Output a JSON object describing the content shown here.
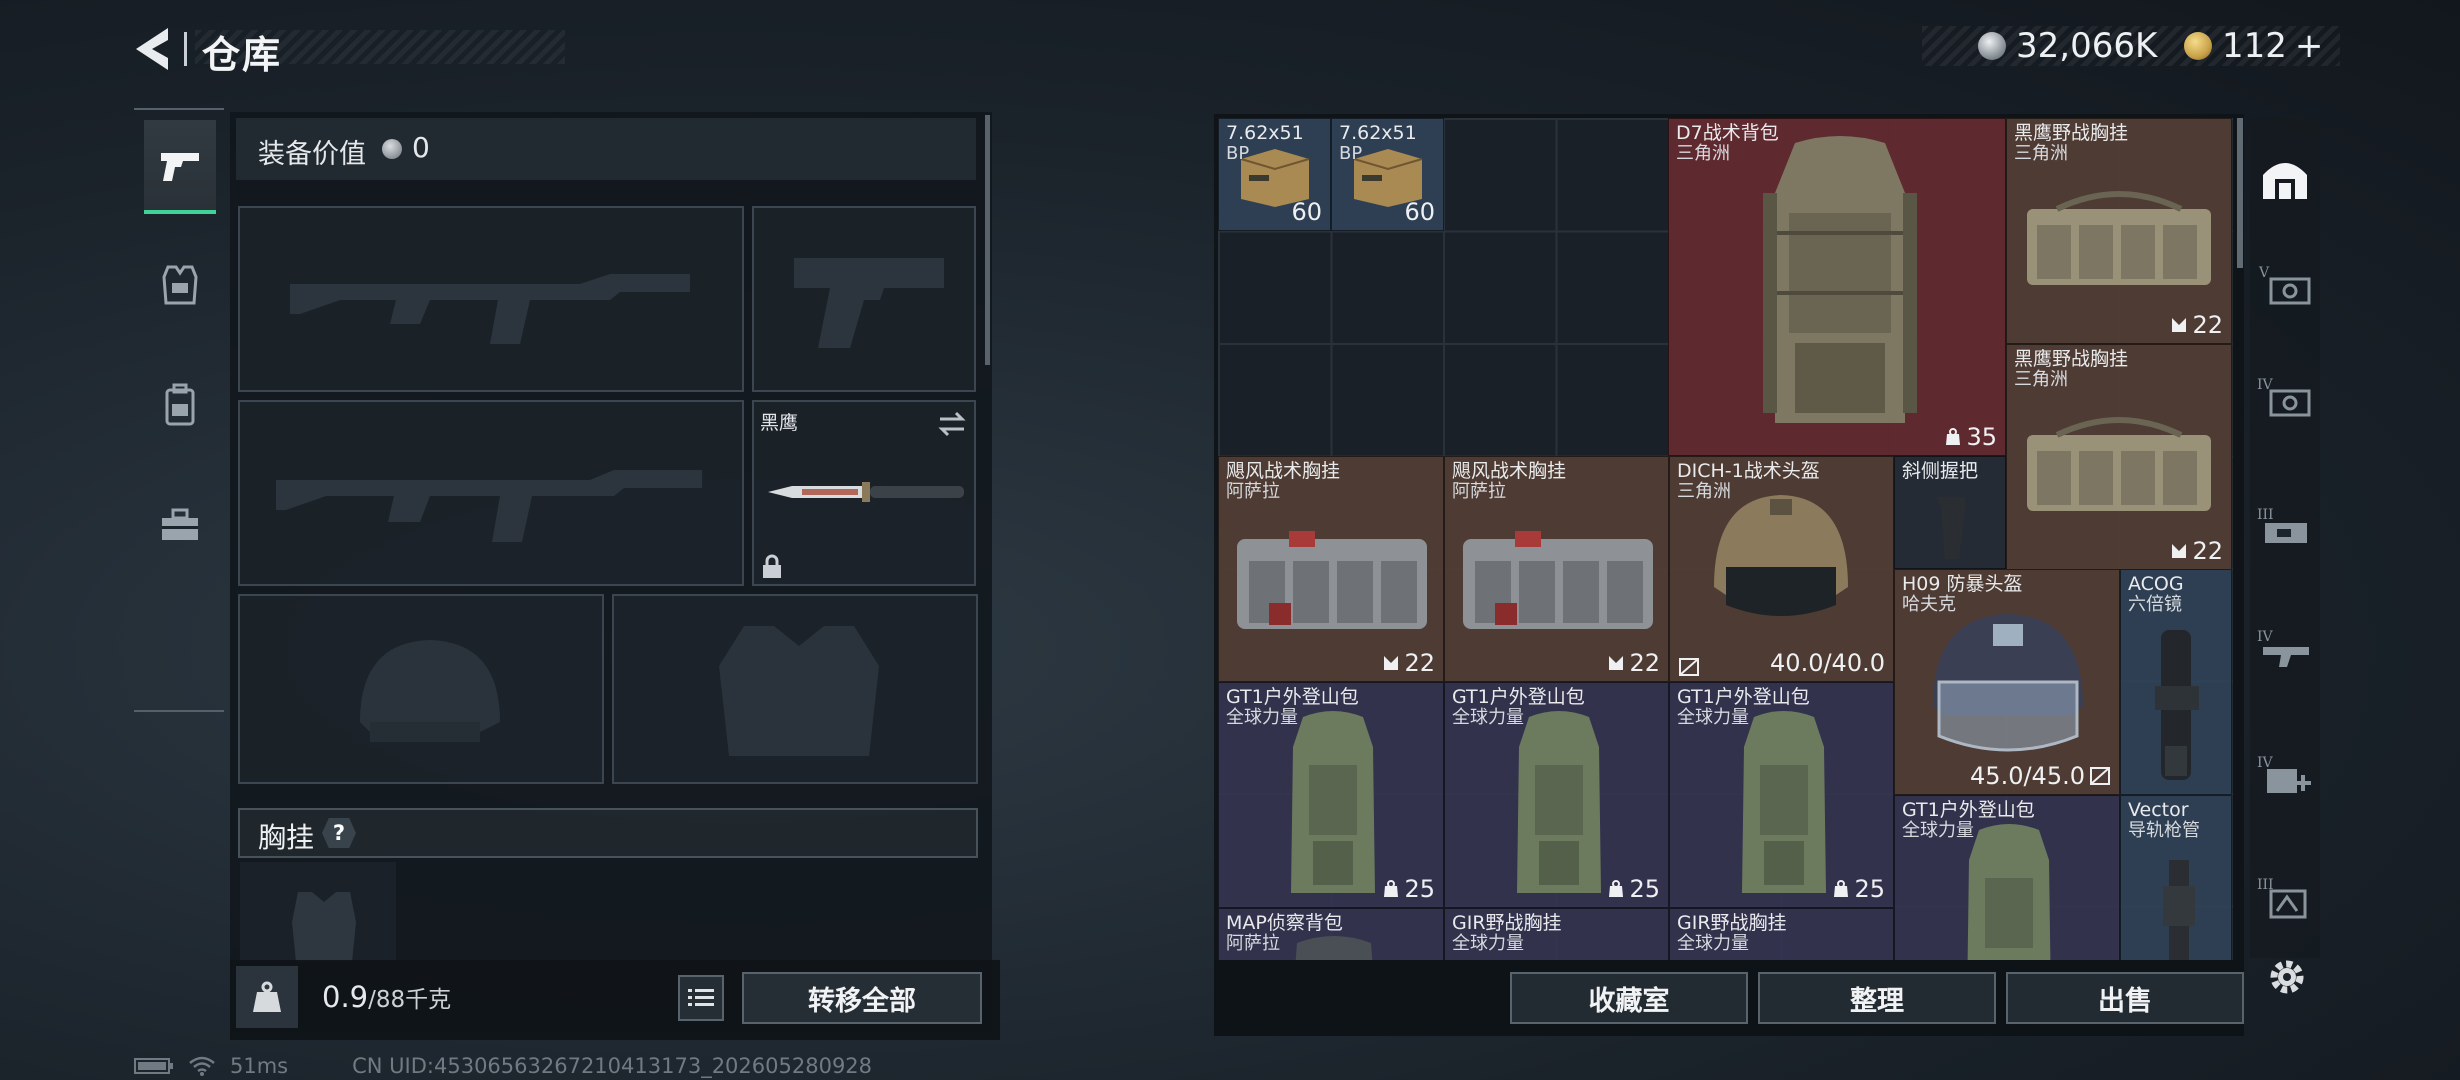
{
  "header": {
    "title": "仓库",
    "currency": [
      {
        "icon": "silver-coin-icon",
        "value": "32,066K"
      },
      {
        "icon": "gold-coin-icon",
        "value": "112",
        "add": "+"
      }
    ]
  },
  "left_nav": {
    "tabs": [
      {
        "name": "weapons",
        "icon": "pistol-icon",
        "active": true
      },
      {
        "name": "armor",
        "icon": "vest-icon",
        "active": false
      },
      {
        "name": "backpack",
        "icon": "backpack-icon",
        "active": false
      },
      {
        "name": "supplies",
        "icon": "toolbox-icon",
        "active": false
      }
    ]
  },
  "loadout": {
    "equip_value_label": "装备价值",
    "equip_value": "0",
    "knife_name": "黑鹰",
    "chest_label": "胸挂",
    "chest_help": "?"
  },
  "weight": {
    "value": "0.9",
    "max": "/88千克"
  },
  "buttons": {
    "transfer_all": "转移全部",
    "collection": "收藏室",
    "organize": "整理",
    "sell": "出售"
  },
  "status": {
    "ping": "51ms",
    "uid": "CN UID:45306563267210413173_202605280928"
  },
  "storage": {
    "items": [
      {
        "name": "7.62x51",
        "sub": "BP",
        "count": "60",
        "count_icon": ""
      },
      {
        "name": "7.62x51",
        "sub": "BP",
        "count": "60",
        "count_icon": ""
      },
      {
        "name": "D7战术背包",
        "sub": "三角洲",
        "count": "35",
        "count_icon": "capacity-icon"
      },
      {
        "name": "黑鹰野战胸挂",
        "sub": "三角洲",
        "count": "22",
        "count_icon": "slots-icon"
      },
      {
        "name": "黑鹰野战胸挂",
        "sub": "三角洲",
        "count": "22",
        "count_icon": "slots-icon"
      },
      {
        "name": "飓风战术胸挂",
        "sub": "阿萨拉",
        "count": "22",
        "count_icon": "slots-icon"
      },
      {
        "name": "飓风战术胸挂",
        "sub": "阿萨拉",
        "count": "22",
        "count_icon": "slots-icon"
      },
      {
        "name": "DICH-1战术头盔",
        "sub": "三角洲",
        "count": "40.0/40.0",
        "count_icon": "durability-icon"
      },
      {
        "name": "斜侧握把",
        "sub": "",
        "count": "",
        "count_icon": ""
      },
      {
        "name": "H09 防暴头盔",
        "sub": "哈夫克",
        "count": "45.0/45.0",
        "count_icon": "durability-icon"
      },
      {
        "name": "ACOG",
        "sub": "六倍镜",
        "count": "",
        "count_icon": ""
      },
      {
        "name": "GT1户外登山包",
        "sub": "全球力量",
        "count": "25",
        "count_icon": "capacity-icon"
      },
      {
        "name": "GT1户外登山包",
        "sub": "全球力量",
        "count": "25",
        "count_icon": "capacity-icon"
      },
      {
        "name": "GT1户外登山包",
        "sub": "全球力量",
        "count": "25",
        "count_icon": "capacity-icon"
      },
      {
        "name": "GT1户外登山包",
        "sub": "全球力量",
        "count": "",
        "count_icon": ""
      },
      {
        "name": "Vector",
        "sub": "导轨枪管",
        "count": "",
        "count_icon": ""
      },
      {
        "name": "MAP侦察背包",
        "sub": "阿萨拉",
        "count": "",
        "count_icon": ""
      },
      {
        "name": "GIR野战胸挂",
        "sub": "全球力量",
        "count": "",
        "count_icon": ""
      },
      {
        "name": "GIR野战胸挂",
        "sub": "全球力量",
        "count": "",
        "count_icon": ""
      }
    ]
  },
  "right_sidebar": {
    "tabs": [
      {
        "icon": "home-storage-icon",
        "active": true
      },
      {
        "icon": "tier-v-storage-icon",
        "active": false
      },
      {
        "icon": "tier-iv-storage-icon",
        "active": false
      },
      {
        "icon": "tier-iii-storage-icon",
        "active": false
      },
      {
        "icon": "tier-iv-weapon-icon",
        "active": false
      },
      {
        "icon": "tier-iv-medical-icon",
        "active": false
      },
      {
        "icon": "tier-iii-equipment-icon",
        "active": false
      }
    ]
  },
  "colors": {
    "accent": "#3fd39a",
    "rarity_blue": "#304258",
    "rarity_red": "#642a30",
    "rarity_brown": "#523e34",
    "rarity_purple": "#343450",
    "gold": "#c9a24a"
  }
}
